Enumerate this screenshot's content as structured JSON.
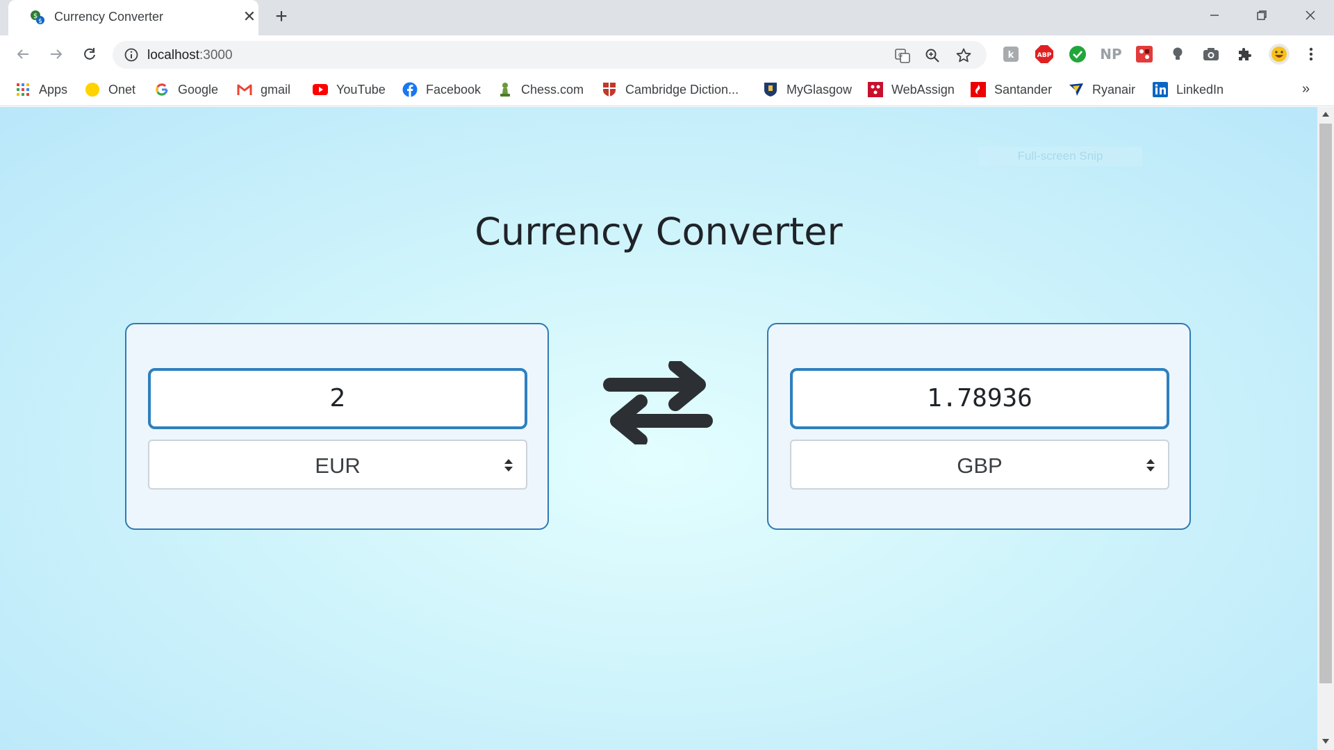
{
  "browser": {
    "tab": {
      "title": "Currency Converter",
      "close": "✕"
    },
    "new_tab": "+",
    "url": {
      "host": "localhost",
      "path": ":3000"
    },
    "bookmarks": [
      {
        "label": "Apps",
        "icon": "apps-grid-icon"
      },
      {
        "label": "Onet",
        "icon": "onet-icon"
      },
      {
        "label": "Google",
        "icon": "google-icon"
      },
      {
        "label": "gmail",
        "icon": "gmail-icon"
      },
      {
        "label": "YouTube",
        "icon": "youtube-icon"
      },
      {
        "label": "Facebook",
        "icon": "facebook-icon"
      },
      {
        "label": "Chess.com",
        "icon": "chess-icon"
      },
      {
        "label": "Cambridge Diction...",
        "icon": "cambridge-icon"
      },
      {
        "label": "MyGlasgow",
        "icon": "glasgow-icon"
      },
      {
        "label": "WebAssign",
        "icon": "webassign-icon"
      },
      {
        "label": "Santander",
        "icon": "santander-icon"
      },
      {
        "label": "Ryanair",
        "icon": "ryanair-icon"
      },
      {
        "label": "LinkedIn",
        "icon": "linkedin-icon"
      }
    ],
    "bookmarks_more": "»",
    "extensions": {
      "abp": "ABP",
      "np": "NP"
    }
  },
  "overlay": {
    "snip": "Full-screen Snip"
  },
  "app": {
    "title": "Currency Converter",
    "from": {
      "amount": "2",
      "currency": "EUR"
    },
    "to": {
      "amount": "1.78936",
      "currency": "GBP"
    }
  },
  "colors": {
    "accent": "#2d80bf",
    "title_text": "#1f2328",
    "card_bg": "#eef6fd",
    "page_bg": "#cff4fb"
  }
}
